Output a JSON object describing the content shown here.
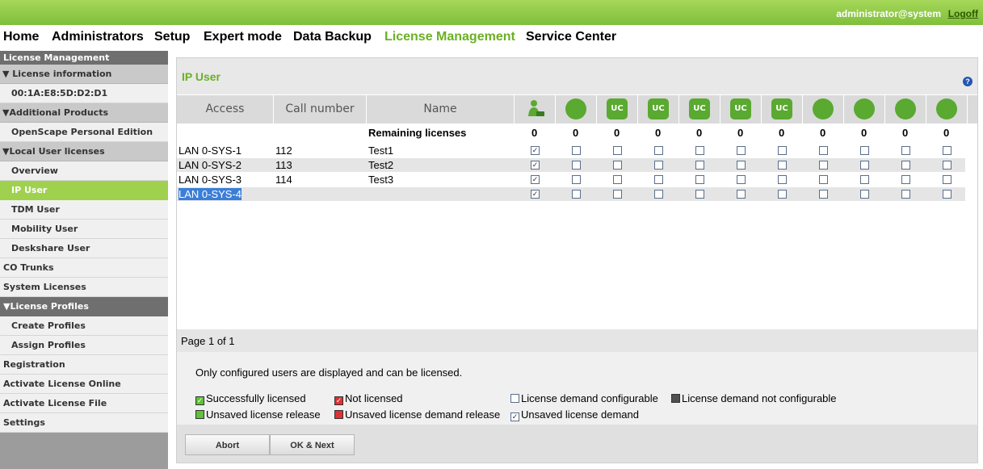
{
  "topbar": {
    "user": "administrator@system",
    "logoff": "Logoff"
  },
  "nav": [
    "Home",
    "Administrators",
    "Setup",
    "Expert mode",
    "Data Backup",
    "License Management",
    "Service Center"
  ],
  "sidebar": [
    {
      "label": "License Management",
      "style": "h"
    },
    {
      "label": "▼ License information",
      "style": "g"
    },
    {
      "label": "00:1A:E8:5D:D2:D1",
      "style": "w"
    },
    {
      "label": "▼Additional Products",
      "style": "g"
    },
    {
      "label": "OpenScape Personal Edition",
      "style": "w"
    },
    {
      "label": "▼Local User licenses",
      "style": "g"
    },
    {
      "label": "Overview",
      "style": "w"
    },
    {
      "label": "IP User",
      "style": "sel"
    },
    {
      "label": "TDM User",
      "style": "w"
    },
    {
      "label": "Mobility User",
      "style": "w"
    },
    {
      "label": "Deskshare User",
      "style": "w"
    },
    {
      "label": "CO Trunks",
      "style": "w"
    },
    {
      "label": "System Licenses",
      "style": "w"
    },
    {
      "label": "▼License Profiles",
      "style": "h"
    },
    {
      "label": "Create Profiles",
      "style": "w"
    },
    {
      "label": "Assign Profiles",
      "style": "w"
    },
    {
      "label": "Registration",
      "style": "w"
    },
    {
      "label": "Activate License Online",
      "style": "w"
    },
    {
      "label": "Activate License File",
      "style": "w"
    },
    {
      "label": "Settings",
      "style": "w"
    }
  ],
  "panel": {
    "title": "IP User",
    "help": "?"
  },
  "columns": {
    "access": "Access",
    "call_number": "Call number",
    "name": "Name"
  },
  "license_icons": [
    "user-phone-icon",
    "user-icon",
    "uc-smile-icon",
    "uc-doc-icon",
    "uc-person-icon",
    "uc-monitor-icon",
    "uc-search-icon",
    "headset-icon",
    "user-badge-icon",
    "mobile-icon",
    "group-icon"
  ],
  "icon_texts": [
    "",
    "",
    "UC",
    "UC",
    "UC",
    "UC",
    "UC",
    "",
    "",
    "",
    ""
  ],
  "remaining": {
    "label": "Remaining licenses",
    "values": [
      "0",
      "0",
      "0",
      "0",
      "0",
      "0",
      "0",
      "0",
      "0",
      "0",
      "0"
    ]
  },
  "rows": [
    {
      "access": "LAN 0-SYS-1",
      "number": "112",
      "name": "Test1",
      "checks": [
        1,
        0,
        0,
        0,
        0,
        0,
        0,
        0,
        0,
        0,
        0
      ]
    },
    {
      "access": "LAN 0-SYS-2",
      "number": "113",
      "name": "Test2",
      "checks": [
        1,
        0,
        0,
        0,
        0,
        0,
        0,
        0,
        0,
        0,
        0
      ]
    },
    {
      "access": "LAN 0-SYS-3",
      "number": "114",
      "name": "Test3",
      "checks": [
        1,
        0,
        0,
        0,
        0,
        0,
        0,
        0,
        0,
        0,
        0
      ]
    },
    {
      "access": "LAN 0-SYS-4",
      "number": "",
      "name": "",
      "checks": [
        1,
        0,
        0,
        0,
        0,
        0,
        0,
        0,
        0,
        0,
        0
      ]
    }
  ],
  "pager": "Page 1 of 1",
  "legend": {
    "note": "Only configured users are displayed and can be licensed.",
    "items": [
      {
        "label": "Successfully licensed",
        "color": "#5fc23a",
        "mark": "✓"
      },
      {
        "label": "Not licensed",
        "color": "#e03030",
        "mark": "✓"
      },
      {
        "label": "License demand configurable",
        "color": "#ffffff",
        "mark": ""
      },
      {
        "label": "License demand not configurable",
        "color": "#505050",
        "mark": ""
      },
      {
        "label": "Unsaved license release",
        "color": "#5fc23a",
        "mark": ""
      },
      {
        "label": "Unsaved license demand release",
        "color": "#e03030",
        "mark": ""
      },
      {
        "label": "Unsaved license demand",
        "color": "#ffffff",
        "mark": "✓"
      }
    ]
  },
  "buttons": {
    "abort": "Abort",
    "ok_next": "OK & Next"
  }
}
